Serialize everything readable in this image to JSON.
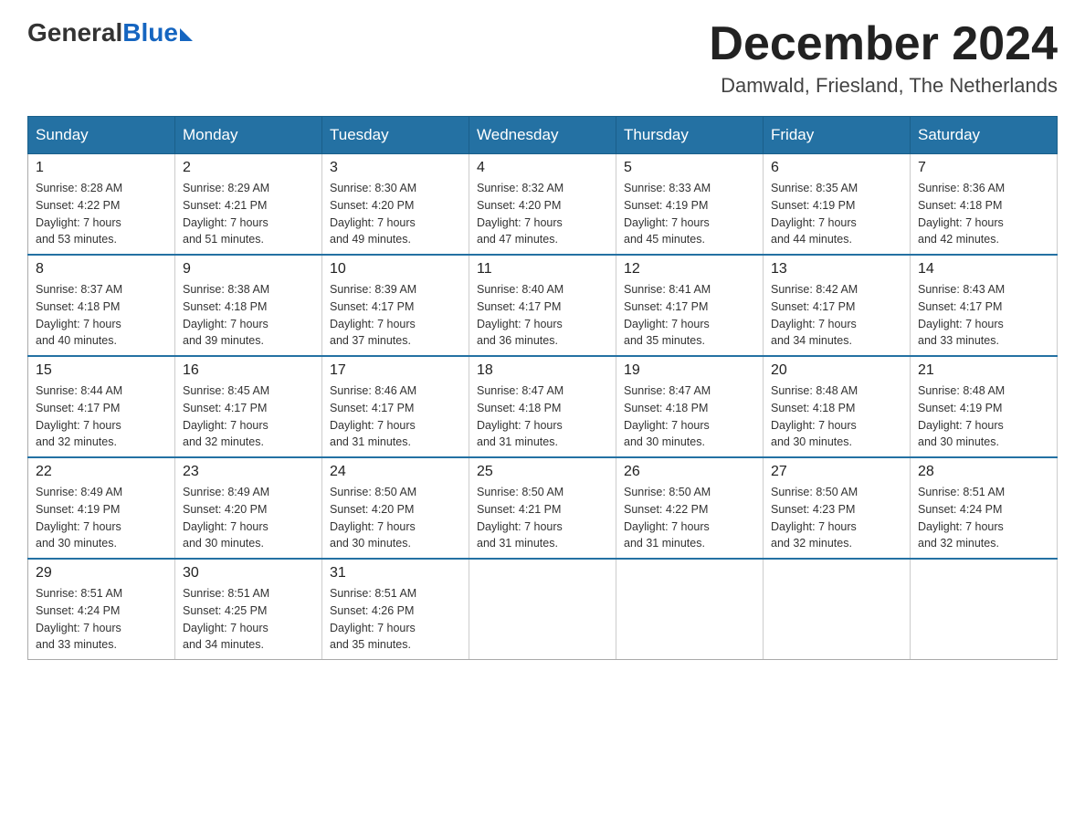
{
  "logo": {
    "general": "General",
    "blue": "Blue"
  },
  "title": {
    "month_year": "December 2024",
    "location": "Damwald, Friesland, The Netherlands"
  },
  "headers": [
    "Sunday",
    "Monday",
    "Tuesday",
    "Wednesday",
    "Thursday",
    "Friday",
    "Saturday"
  ],
  "weeks": [
    [
      {
        "day": "1",
        "sunrise": "8:28 AM",
        "sunset": "4:22 PM",
        "daylight": "7 hours and 53 minutes."
      },
      {
        "day": "2",
        "sunrise": "8:29 AM",
        "sunset": "4:21 PM",
        "daylight": "7 hours and 51 minutes."
      },
      {
        "day": "3",
        "sunrise": "8:30 AM",
        "sunset": "4:20 PM",
        "daylight": "7 hours and 49 minutes."
      },
      {
        "day": "4",
        "sunrise": "8:32 AM",
        "sunset": "4:20 PM",
        "daylight": "7 hours and 47 minutes."
      },
      {
        "day": "5",
        "sunrise": "8:33 AM",
        "sunset": "4:19 PM",
        "daylight": "7 hours and 45 minutes."
      },
      {
        "day": "6",
        "sunrise": "8:35 AM",
        "sunset": "4:19 PM",
        "daylight": "7 hours and 44 minutes."
      },
      {
        "day": "7",
        "sunrise": "8:36 AM",
        "sunset": "4:18 PM",
        "daylight": "7 hours and 42 minutes."
      }
    ],
    [
      {
        "day": "8",
        "sunrise": "8:37 AM",
        "sunset": "4:18 PM",
        "daylight": "7 hours and 40 minutes."
      },
      {
        "day": "9",
        "sunrise": "8:38 AM",
        "sunset": "4:18 PM",
        "daylight": "7 hours and 39 minutes."
      },
      {
        "day": "10",
        "sunrise": "8:39 AM",
        "sunset": "4:17 PM",
        "daylight": "7 hours and 37 minutes."
      },
      {
        "day": "11",
        "sunrise": "8:40 AM",
        "sunset": "4:17 PM",
        "daylight": "7 hours and 36 minutes."
      },
      {
        "day": "12",
        "sunrise": "8:41 AM",
        "sunset": "4:17 PM",
        "daylight": "7 hours and 35 minutes."
      },
      {
        "day": "13",
        "sunrise": "8:42 AM",
        "sunset": "4:17 PM",
        "daylight": "7 hours and 34 minutes."
      },
      {
        "day": "14",
        "sunrise": "8:43 AM",
        "sunset": "4:17 PM",
        "daylight": "7 hours and 33 minutes."
      }
    ],
    [
      {
        "day": "15",
        "sunrise": "8:44 AM",
        "sunset": "4:17 PM",
        "daylight": "7 hours and 32 minutes."
      },
      {
        "day": "16",
        "sunrise": "8:45 AM",
        "sunset": "4:17 PM",
        "daylight": "7 hours and 32 minutes."
      },
      {
        "day": "17",
        "sunrise": "8:46 AM",
        "sunset": "4:17 PM",
        "daylight": "7 hours and 31 minutes."
      },
      {
        "day": "18",
        "sunrise": "8:47 AM",
        "sunset": "4:18 PM",
        "daylight": "7 hours and 31 minutes."
      },
      {
        "day": "19",
        "sunrise": "8:47 AM",
        "sunset": "4:18 PM",
        "daylight": "7 hours and 30 minutes."
      },
      {
        "day": "20",
        "sunrise": "8:48 AM",
        "sunset": "4:18 PM",
        "daylight": "7 hours and 30 minutes."
      },
      {
        "day": "21",
        "sunrise": "8:48 AM",
        "sunset": "4:19 PM",
        "daylight": "7 hours and 30 minutes."
      }
    ],
    [
      {
        "day": "22",
        "sunrise": "8:49 AM",
        "sunset": "4:19 PM",
        "daylight": "7 hours and 30 minutes."
      },
      {
        "day": "23",
        "sunrise": "8:49 AM",
        "sunset": "4:20 PM",
        "daylight": "7 hours and 30 minutes."
      },
      {
        "day": "24",
        "sunrise": "8:50 AM",
        "sunset": "4:20 PM",
        "daylight": "7 hours and 30 minutes."
      },
      {
        "day": "25",
        "sunrise": "8:50 AM",
        "sunset": "4:21 PM",
        "daylight": "7 hours and 31 minutes."
      },
      {
        "day": "26",
        "sunrise": "8:50 AM",
        "sunset": "4:22 PM",
        "daylight": "7 hours and 31 minutes."
      },
      {
        "day": "27",
        "sunrise": "8:50 AM",
        "sunset": "4:23 PM",
        "daylight": "7 hours and 32 minutes."
      },
      {
        "day": "28",
        "sunrise": "8:51 AM",
        "sunset": "4:24 PM",
        "daylight": "7 hours and 32 minutes."
      }
    ],
    [
      {
        "day": "29",
        "sunrise": "8:51 AM",
        "sunset": "4:24 PM",
        "daylight": "7 hours and 33 minutes."
      },
      {
        "day": "30",
        "sunrise": "8:51 AM",
        "sunset": "4:25 PM",
        "daylight": "7 hours and 34 minutes."
      },
      {
        "day": "31",
        "sunrise": "8:51 AM",
        "sunset": "4:26 PM",
        "daylight": "7 hours and 35 minutes."
      },
      null,
      null,
      null,
      null
    ]
  ],
  "labels": {
    "sunrise_prefix": "Sunrise: ",
    "sunset_prefix": "Sunset: ",
    "daylight_prefix": "Daylight: "
  }
}
